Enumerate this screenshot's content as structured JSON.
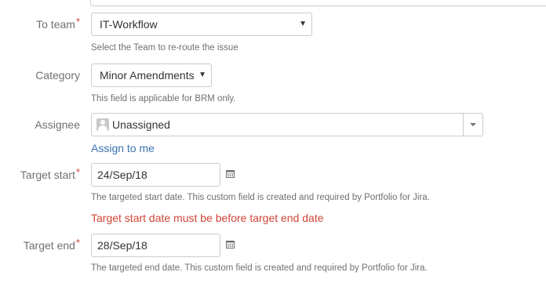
{
  "to_team": {
    "label": "To team",
    "required_mark": "*",
    "value": "IT-Workflow",
    "description": "Select the Team to re-route the issue"
  },
  "category": {
    "label": "Category",
    "value": "Minor Amendments",
    "description": "This field is applicable for BRM only."
  },
  "assignee": {
    "label": "Assignee",
    "value": "Unassigned",
    "assign_to_me": "Assign to me"
  },
  "target_start": {
    "label": "Target start",
    "required_mark": "*",
    "value": "24/Sep/18",
    "description": "The targeted start date. This custom field is created and required by Portfolio for Jira.",
    "error": "Target start date must be before target end date"
  },
  "target_end": {
    "label": "Target end",
    "required_mark": "*",
    "value": "28/Sep/18",
    "description": "The targeted end date. This custom field is created and required by Portfolio for Jira."
  },
  "colors": {
    "error": "#d04437",
    "link": "#3b73af",
    "label": "#707070",
    "border": "#cccccc"
  },
  "icons": [
    "chevron-down-icon",
    "avatar-icon",
    "calendar-icon"
  ]
}
